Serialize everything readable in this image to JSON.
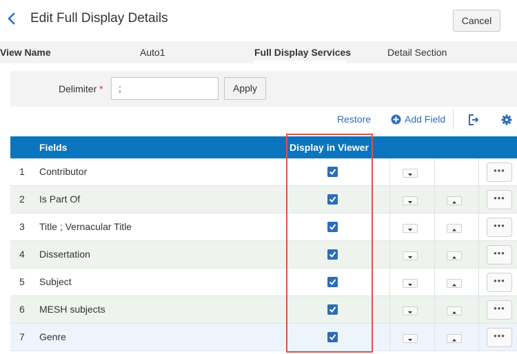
{
  "header": {
    "title": "Edit Full Display Details",
    "cancel_label": "Cancel"
  },
  "tabs": {
    "view_name_label": "View Name",
    "view_name_value": "Auto1",
    "full_display_services": "Full Display Services",
    "detail_section": "Detail Section"
  },
  "delimiter": {
    "label": "Delimiter",
    "required_mark": "*",
    "value": ";",
    "apply_label": "Apply"
  },
  "toolbar": {
    "restore_label": "Restore",
    "add_field_label": "Add Field"
  },
  "table": {
    "columns": {
      "fields": "Fields",
      "display_in_viewer": "Display in Viewer"
    },
    "rows": [
      {
        "num": "1",
        "name": "Contributor",
        "checked": true
      },
      {
        "num": "2",
        "name": "Is Part Of",
        "checked": true
      },
      {
        "num": "3",
        "name": "Title ; Vernacular Title",
        "checked": true
      },
      {
        "num": "4",
        "name": "Dissertation",
        "checked": true
      },
      {
        "num": "5",
        "name": "Subject",
        "checked": true
      },
      {
        "num": "6",
        "name": "MESH subjects",
        "checked": true
      },
      {
        "num": "7",
        "name": "Genre",
        "checked": true
      }
    ],
    "more_label": "•••"
  },
  "colors": {
    "accent": "#2a6ebb",
    "header_bg": "#0a75be",
    "highlight": "#d9534f"
  }
}
